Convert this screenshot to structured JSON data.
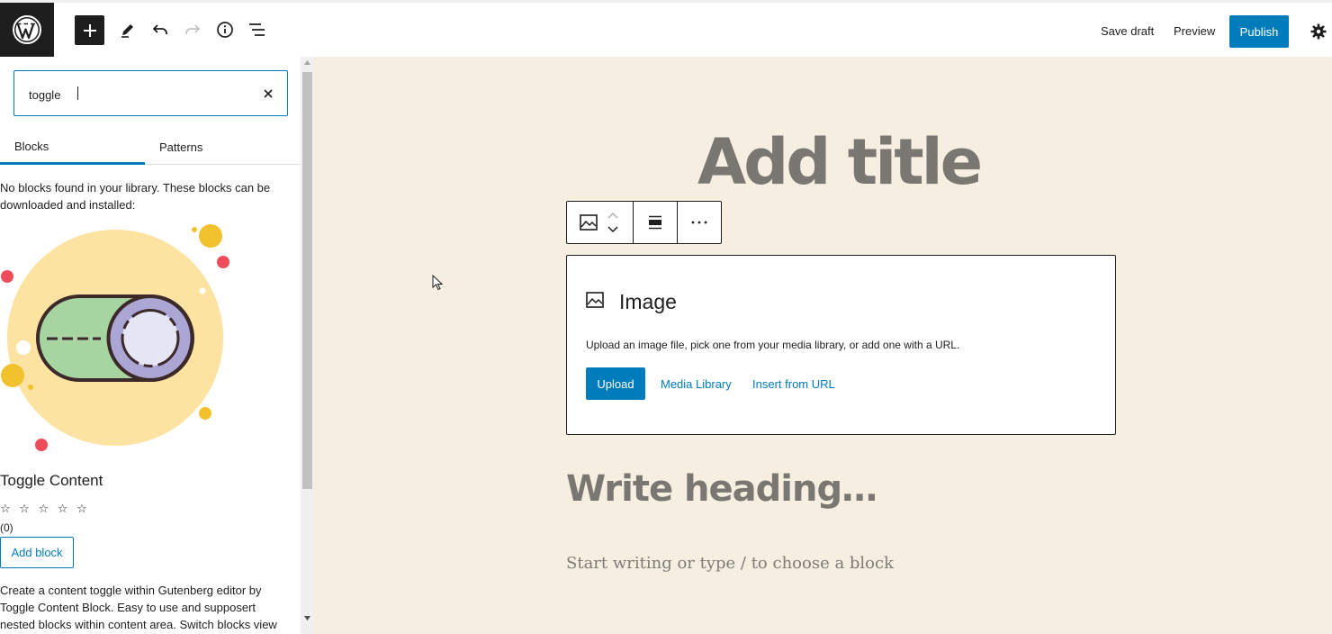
{
  "topbar": {
    "logo_icon": "wordpress-logo-icon",
    "add_icon": "plus-icon",
    "tools_icon": "pencil-icon",
    "undo_icon": "undo-icon",
    "redo_icon": "redo-icon",
    "details_icon": "info-icon",
    "outline_icon": "list-view-icon",
    "save_draft_label": "Save draft",
    "preview_label": "Preview",
    "publish_label": "Publish",
    "settings_icon": "gear-icon",
    "accent_color": "#007cba"
  },
  "inserter": {
    "search": {
      "value": "toggle",
      "clear_icon": "close-icon"
    },
    "tabs": [
      {
        "label": "Blocks",
        "active": true
      },
      {
        "label": "Patterns",
        "active": false
      }
    ],
    "no_results_text": "No blocks found in your library. These blocks can be downloaded and installed:",
    "result": {
      "name": "Toggle Content",
      "stars": "☆ ☆ ☆ ☆ ☆",
      "rating_count": "(0)",
      "add_label": "Add block",
      "description": "Create a content toggle within Gutenberg editor by Toggle Content Block. Easy to use and supposert nested blocks within content area. Switch blocks view with an"
    }
  },
  "canvas": {
    "background": "#f5eee1",
    "title_placeholder": "Add title",
    "block_toolbar": {
      "block_icon": "image-icon",
      "move_icon": "chevron-up-down-icon",
      "align_icon": "align-icon",
      "more_icon": "more-options-icon"
    },
    "image_block": {
      "title": "Image",
      "description": "Upload an image file, pick one from your media library, or add one with a URL.",
      "upload_label": "Upload",
      "media_library_label": "Media Library",
      "insert_url_label": "Insert from URL"
    },
    "heading_placeholder": "Write heading…",
    "paragraph_placeholder": "Start writing or type / to choose a block"
  }
}
